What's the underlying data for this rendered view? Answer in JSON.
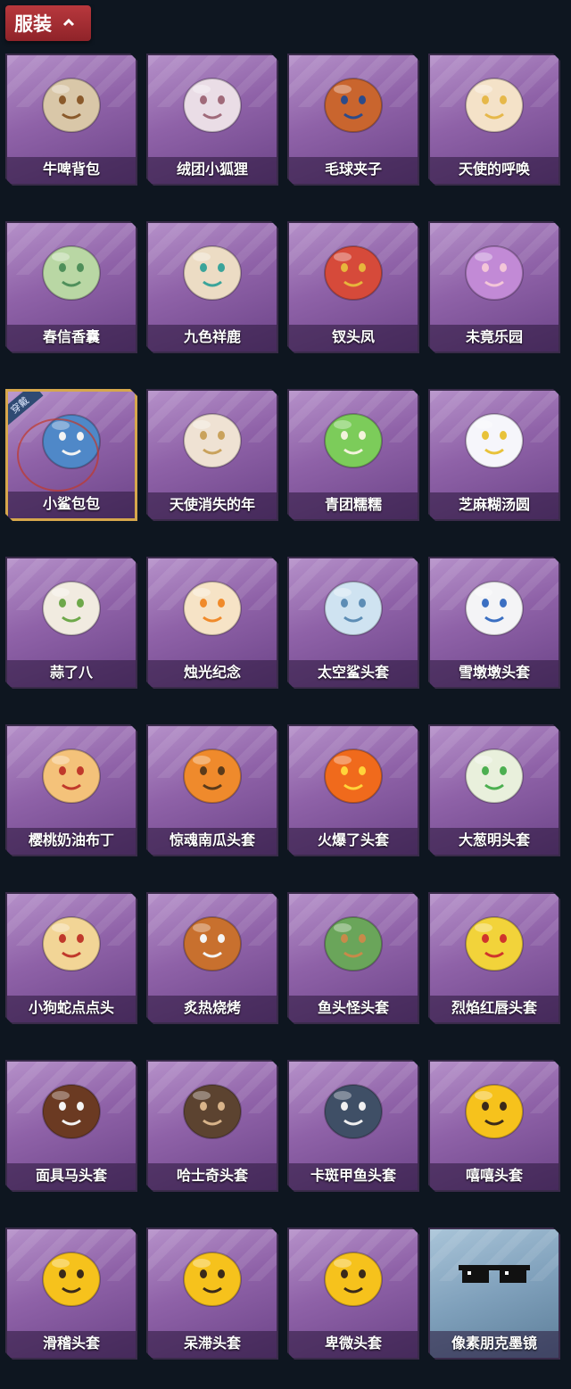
{
  "header": {
    "tab_label": "服装"
  },
  "worn_badge": "穿戴",
  "items": [
    {
      "name": "牛啤背包",
      "icon": "cow-beer-backpack-icon",
      "color": "#d9c7a8",
      "accent": "#8a5a2b"
    },
    {
      "name": "绒团小狐狸",
      "icon": "fluffy-fox-icon",
      "color": "#eadde6",
      "accent": "#a06a7a"
    },
    {
      "name": "毛球夹子",
      "icon": "red-panda-clip-icon",
      "color": "#c9652e",
      "accent": "#2c4b8a"
    },
    {
      "name": "天使的呼唤",
      "icon": "angel-call-icon",
      "color": "#f4e2c8",
      "accent": "#e6b84a"
    },
    {
      "name": "春信香囊",
      "icon": "sachet-icon",
      "color": "#b9d7a4",
      "accent": "#4f8f5a"
    },
    {
      "name": "九色祥鹿",
      "icon": "nine-color-deer-icon",
      "color": "#ecdcc4",
      "accent": "#3aa49a"
    },
    {
      "name": "钗头凤",
      "icon": "phoenix-hairpin-icon",
      "color": "#d64a3a",
      "accent": "#e7b63c"
    },
    {
      "name": "未竟乐园",
      "icon": "unfinished-paradise-icon",
      "color": "#c28ad6",
      "accent": "#f3c6d8"
    },
    {
      "name": "小鲨包包",
      "icon": "shark-bag-icon",
      "color": "#4f88c8",
      "accent": "#f3f3f3",
      "worn": true
    },
    {
      "name": "天使消失的年",
      "icon": "vanished-angel-icon",
      "color": "#efe2d3",
      "accent": "#c9a25c"
    },
    {
      "name": "青团糯糯",
      "icon": "green-dumpling-icon",
      "color": "#7ccc5a",
      "accent": "#f3f3dc"
    },
    {
      "name": "芝麻糊汤圆",
      "icon": "sesame-tangyuan-icon",
      "color": "#f6f6fb",
      "accent": "#e8c23a"
    },
    {
      "name": "蒜了八",
      "icon": "garlic-icon",
      "color": "#f1ebe0",
      "accent": "#6ea84a"
    },
    {
      "name": "烛光纪念",
      "icon": "candle-icon",
      "color": "#f6e3c6",
      "accent": "#f08a2a"
    },
    {
      "name": "太空鲨头套",
      "icon": "space-shark-hood-icon",
      "color": "#cfe3f1",
      "accent": "#5d8db5"
    },
    {
      "name": "雪墩墩头套",
      "icon": "snowman-hood-icon",
      "color": "#f4f4f6",
      "accent": "#3b6fc2"
    },
    {
      "name": "樱桃奶油布丁",
      "icon": "cherry-pudding-icon",
      "color": "#f4c27a",
      "accent": "#c0392b"
    },
    {
      "name": "惊魂南瓜头套",
      "icon": "pumpkin-hood-icon",
      "color": "#ef8a2c",
      "accent": "#5a3a1a"
    },
    {
      "name": "火爆了头套",
      "icon": "fire-hood-icon",
      "color": "#f06a1c",
      "accent": "#ffd43a"
    },
    {
      "name": "大葱明头套",
      "icon": "scallion-hood-icon",
      "color": "#e9f0dc",
      "accent": "#4caf50"
    },
    {
      "name": "小狗蛇点点头",
      "icon": "dog-snake-icon",
      "color": "#f2d596",
      "accent": "#c0392b"
    },
    {
      "name": "炙热烧烤",
      "icon": "grill-meat-icon",
      "color": "#c8702e",
      "accent": "#f4f4f4"
    },
    {
      "name": "鱼头怪头套",
      "icon": "fish-head-hood-icon",
      "color": "#6aa55a",
      "accent": "#c88a4a"
    },
    {
      "name": "烈焰红唇头套",
      "icon": "red-lips-hood-icon",
      "color": "#f2d33a",
      "accent": "#d0342c"
    },
    {
      "name": "面具马头套",
      "icon": "horse-mask-icon",
      "color": "#6b3a22",
      "accent": "#f4f4f4"
    },
    {
      "name": "哈士奇头套",
      "icon": "husky-hood-icon",
      "color": "#5c4330",
      "accent": "#d9b48a"
    },
    {
      "name": "卡斑甲鱼头套",
      "icon": "kaban-fish-hood-icon",
      "color": "#3f4f66",
      "accent": "#f0f0f0"
    },
    {
      "name": "嘻嘻头套",
      "icon": "grin-hood-icon",
      "color": "#f6c21c",
      "accent": "#3a2a1a"
    },
    {
      "name": "滑稽头套",
      "icon": "funny-face-hood-icon",
      "color": "#f6c21c",
      "accent": "#3a2a1a"
    },
    {
      "name": "呆滞头套",
      "icon": "dazed-face-hood-icon",
      "color": "#f6c21c",
      "accent": "#3a2a1a"
    },
    {
      "name": "卑微头套",
      "icon": "humble-face-hood-icon",
      "color": "#f6c21c",
      "accent": "#3a2a1a"
    },
    {
      "name": "像素朋克墨镜",
      "icon": "pixel-sunglasses-icon",
      "color": "#111111",
      "accent": "#ffffff",
      "blue": true
    }
  ]
}
